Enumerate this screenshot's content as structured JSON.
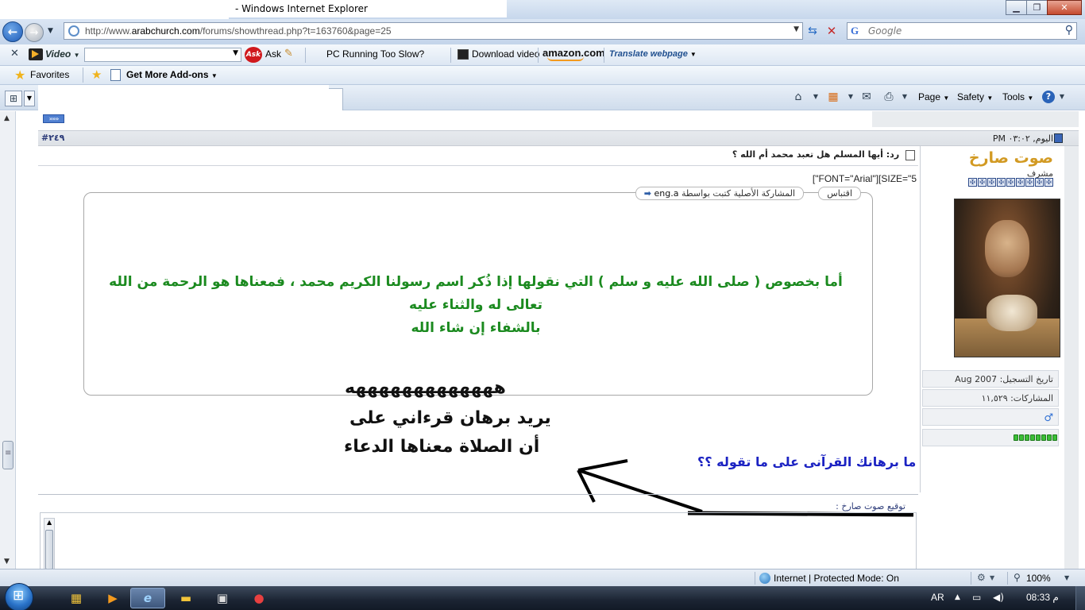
{
  "window": {
    "title": "- Windows Internet Explorer",
    "minimize": "▁",
    "maximize": "❐",
    "close": "✕"
  },
  "address_bar": {
    "url_prefix": "http://www.",
    "url_domain": "arabchurch.com",
    "url_path": "/forums/showthread.php?t=163760&page=25",
    "search_placeholder": "Google"
  },
  "toolbar": {
    "video_label": "Video",
    "ask_label": "Ask",
    "ask_logo": "Ask",
    "pc_slow_label": "PC Running Too Slow?",
    "download_label": "Download video",
    "amazon_label": "amazon.com",
    "translate_label": "Translate webpage"
  },
  "favorites_bar": {
    "favorites_label": "Favorites",
    "addons_label": "Get More Add-ons"
  },
  "command_bar": {
    "page_label": "Page",
    "safety_label": "Safety",
    "tools_label": "Tools"
  },
  "post": {
    "number": "#٢٤٩",
    "time": "اليوم, ٠٣:٠٢ PM",
    "title": "رد: أيها المسلم هل تعبد محمد أم الله ؟",
    "font_tag": "[\"FONT=\"Arial\"][SIZE=\"5",
    "quote_button": "اقتباس",
    "quote_author_prefix": "المشاركة الأصلية كتبت بواسطة",
    "quote_author": "eng.a",
    "quote_text_line1": "أما بخصوص ( صلى الله عليه و سلم ) التي نقولها إذا ذُكر اسم رسولنا الكريم محمد ، فمعناها هو الرحمة من الله تعالى له والثناء عليه",
    "quote_text_line2": "بالشفاء إن شاء الله",
    "laugh_text": "هههههههههههههه",
    "reply_line1": "يريد برهان قرءاني على",
    "reply_line2": "أن الصلاة معناها الدعاء",
    "question_text": "ما برهانك القرآنى على ما تقوله ؟؟",
    "signature_label": "توقيع صوت صارخ :"
  },
  "user": {
    "name": "صوت صارخ",
    "title": "مشرف",
    "join_date": "تاريخ التسجيل: Aug 2007",
    "posts": "المشاركات: ١١,٥٢٩",
    "gender_icon": "♂"
  },
  "status_bar": {
    "zone_text": "Internet | Protected Mode: On",
    "zoom": "100%"
  },
  "taskbar": {
    "language": "AR",
    "time": "08:33 م"
  },
  "colors": {
    "quote_text": "#1b8a1f",
    "username": "#d29a23",
    "question": "#1b22c2",
    "reputation": "#3cbe37"
  }
}
